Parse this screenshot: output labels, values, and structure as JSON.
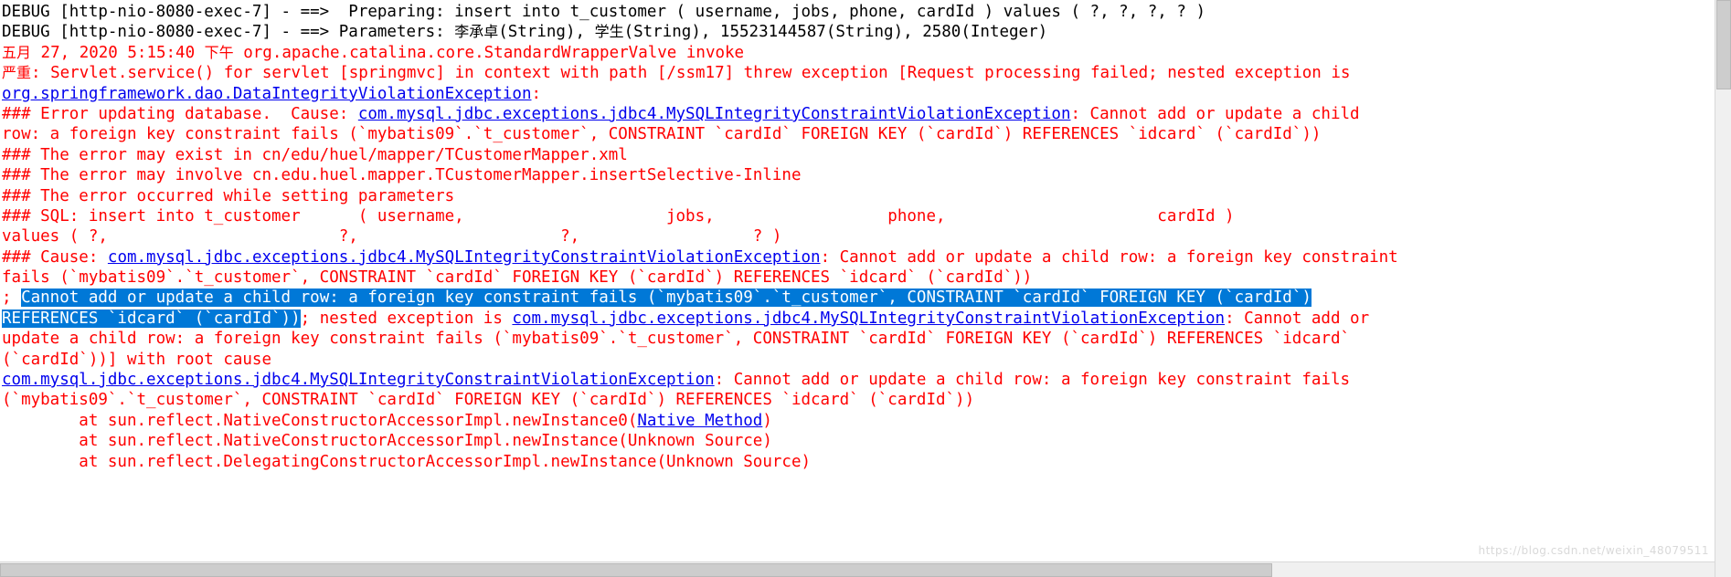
{
  "app": {
    "type": "ide-console",
    "colors": {
      "background": "#ffffff",
      "debug_text": "#000000",
      "error_text": "#ff0000",
      "hyperlink": "#0000ee",
      "selection_background": "#0078d7",
      "selection_text": "#ffffff",
      "scrollbar_track": "#f0f0f0",
      "scrollbar_thumb": "#cdcdcd"
    }
  },
  "watermark": {
    "text": "https://blog.csdn.net/weixin_48079511"
  },
  "scrollbars": {
    "vertical_name": "vertical-scrollbar",
    "horizontal_name": "horizontal-scrollbar"
  },
  "console": {
    "lines": [
      {
        "id": "line-01",
        "name": "console-line-debug-preparing",
        "segments": [
          {
            "style": "black",
            "text": "DEBUG [http-nio-8080-exec-7] - ==>  Preparing: insert into t_customer ( username, jobs, phone, cardId ) values ( ?, ?, ?, ? )"
          }
        ]
      },
      {
        "id": "line-02",
        "name": "console-line-debug-parameters",
        "segments": [
          {
            "style": "black",
            "text": "DEBUG [http-nio-8080-exec-7] - ==> Parameters: "
          },
          {
            "style": "black-cjk",
            "text": "李承卓"
          },
          {
            "style": "black",
            "text": "(String), "
          },
          {
            "style": "black-cjk",
            "text": "学生"
          },
          {
            "style": "black",
            "text": "(String), 15523144587(String), 2580(Integer)"
          }
        ]
      },
      {
        "id": "line-03",
        "name": "console-line-timestamp",
        "segments": [
          {
            "style": "red-cjk",
            "text": "五月"
          },
          {
            "style": "red",
            "text": " 27, 2020 5:15:40 "
          },
          {
            "style": "red-cjk",
            "text": "下午"
          },
          {
            "style": "red",
            "text": " org.apache.catalina.core.StandardWrapperValve invoke"
          }
        ]
      },
      {
        "id": "line-04",
        "name": "console-line-severe",
        "segments": [
          {
            "style": "red-cjk",
            "text": "严重"
          },
          {
            "style": "red",
            "text": ": Servlet.service() for servlet [springmvc] in context with path [/ssm17] threw exception [Request processing failed; nested exception is"
          }
        ]
      },
      {
        "id": "line-05",
        "name": "console-line-dao-exception",
        "segments": [
          {
            "style": "link",
            "text": "org.springframework.dao.DataIntegrityViolationException"
          },
          {
            "style": "red",
            "text": ":"
          }
        ]
      },
      {
        "id": "line-06",
        "name": "console-line-error-updating-database",
        "segments": [
          {
            "style": "red",
            "text": "### Error updating database.  Cause: "
          },
          {
            "style": "link",
            "text": "com.mysql.jdbc.exceptions.jdbc4.MySQLIntegrityConstraintViolationException"
          },
          {
            "style": "red",
            "text": ": Cannot add or update a child"
          }
        ]
      },
      {
        "id": "line-07",
        "name": "console-line-fk-constraint-1",
        "segments": [
          {
            "style": "red",
            "text": "row: a foreign key constraint fails (`mybatis09`.`t_customer`, CONSTRAINT `cardId` FOREIGN KEY (`cardId`) REFERENCES `idcard` (`cardId`))"
          }
        ]
      },
      {
        "id": "line-08",
        "name": "console-line-error-may-exist",
        "segments": [
          {
            "style": "red",
            "text": "### The error may exist in cn/edu/huel/mapper/TCustomerMapper.xml"
          }
        ]
      },
      {
        "id": "line-09",
        "name": "console-line-error-may-involve",
        "segments": [
          {
            "style": "red",
            "text": "### The error may involve cn.edu.huel.mapper.TCustomerMapper.insertSelective-Inline"
          }
        ]
      },
      {
        "id": "line-10",
        "name": "console-line-error-occurred",
        "segments": [
          {
            "style": "red",
            "text": "### The error occurred while setting parameters"
          }
        ]
      },
      {
        "id": "line-11",
        "name": "console-line-sql-statement",
        "segments": [
          {
            "style": "red",
            "text": "### SQL: insert into t_customer      ( username,                     jobs,                  phone,                      cardId )"
          }
        ]
      },
      {
        "id": "line-12",
        "name": "console-line-sql-values",
        "segments": [
          {
            "style": "red",
            "text": "values ( ?,                        ?,                     ?,                  ? )"
          }
        ]
      },
      {
        "id": "line-13",
        "name": "console-line-cause",
        "segments": [
          {
            "style": "red",
            "text": "### Cause: "
          },
          {
            "style": "link",
            "text": "com.mysql.jdbc.exceptions.jdbc4.MySQLIntegrityConstraintViolationException"
          },
          {
            "style": "red",
            "text": ": Cannot add or update a child row: a foreign key constraint"
          }
        ]
      },
      {
        "id": "line-14",
        "name": "console-line-fk-constraint-2",
        "segments": [
          {
            "style": "red",
            "text": "fails (`mybatis09`.`t_customer`, CONSTRAINT `cardId` FOREIGN KEY (`cardId`) REFERENCES `idcard` (`cardId`))"
          }
        ]
      },
      {
        "id": "line-15",
        "name": "console-line-selected-1",
        "selected": true,
        "segments": [
          {
            "style": "red",
            "text": "; "
          },
          {
            "style": "selected",
            "text": "Cannot add or update a child row: a foreign key constraint fails (`mybatis09`.`t_customer`, CONSTRAINT `cardId` FOREIGN KEY (`cardId`)"
          }
        ]
      },
      {
        "id": "line-16",
        "name": "console-line-selected-2",
        "selected": true,
        "segments": [
          {
            "style": "selected",
            "text": "REFERENCES `idcard` (`cardId`))"
          },
          {
            "style": "red",
            "text": "; nested exception is "
          },
          {
            "style": "link",
            "text": "com.mysql.jdbc.exceptions.jdbc4.MySQLIntegrityConstraintViolationException"
          },
          {
            "style": "red",
            "text": ": Cannot add or"
          }
        ]
      },
      {
        "id": "line-17",
        "name": "console-line-fk-constraint-3",
        "segments": [
          {
            "style": "red",
            "text": "update a child row: a foreign key constraint fails (`mybatis09`.`t_customer`, CONSTRAINT `cardId` FOREIGN KEY (`cardId`) REFERENCES `idcard`"
          }
        ]
      },
      {
        "id": "line-18",
        "name": "console-line-root-cause",
        "segments": [
          {
            "style": "red",
            "text": "(`cardId`))] with root cause"
          }
        ]
      },
      {
        "id": "line-19",
        "name": "console-line-root-exception",
        "segments": [
          {
            "style": "link",
            "text": "com.mysql.jdbc.exceptions.jdbc4.MySQLIntegrityConstraintViolationException"
          },
          {
            "style": "red",
            "text": ": Cannot add or update a child row: a foreign key constraint fails"
          }
        ]
      },
      {
        "id": "line-20",
        "name": "console-line-fk-constraint-4",
        "segments": [
          {
            "style": "red",
            "text": "(`mybatis09`.`t_customer`, CONSTRAINT `cardId` FOREIGN KEY (`cardId`) REFERENCES `idcard` (`cardId`))"
          }
        ]
      },
      {
        "id": "line-21",
        "name": "console-line-stacktrace-1",
        "segments": [
          {
            "style": "red",
            "text": "        at sun.reflect.NativeConstructorAccessorImpl.newInstance0("
          },
          {
            "style": "link",
            "text": "Native Method"
          },
          {
            "style": "red",
            "text": ")"
          }
        ]
      },
      {
        "id": "line-22",
        "name": "console-line-stacktrace-2",
        "segments": [
          {
            "style": "red",
            "text": "        at sun.reflect.NativeConstructorAccessorImpl.newInstance(Unknown Source)"
          }
        ]
      },
      {
        "id": "line-23",
        "name": "console-line-stacktrace-3",
        "segments": [
          {
            "style": "red",
            "text": "        at sun.reflect.DelegatingConstructorAccessorImpl.newInstance(Unknown Source)"
          }
        ]
      }
    ]
  }
}
